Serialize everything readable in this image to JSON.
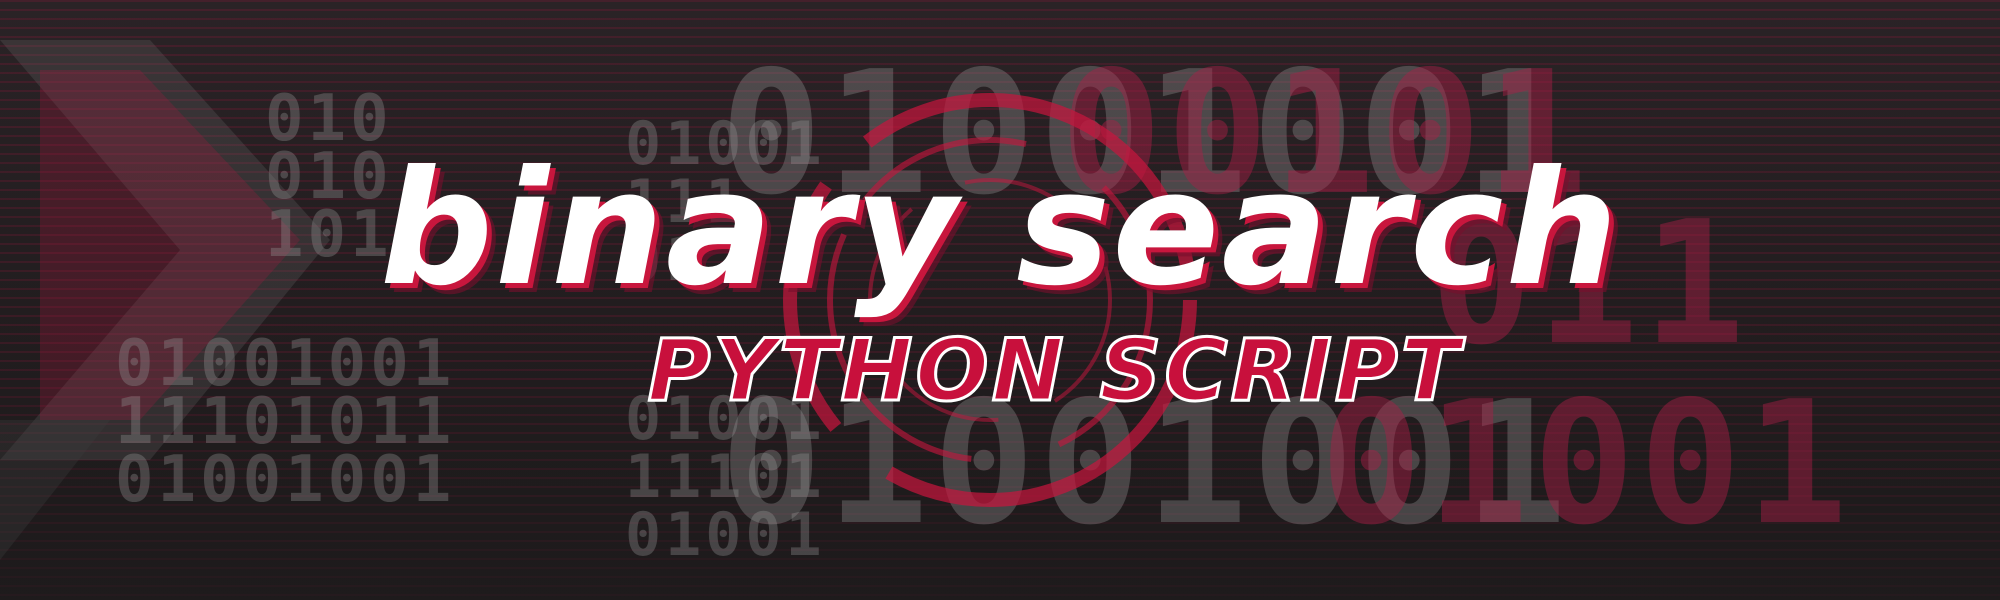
{
  "banner": {
    "title": "binary search",
    "subtitle": "PYTHON SCRIPT",
    "colors": {
      "background": "#221d1f",
      "accent": "#c8163d",
      "text": "#ffffff"
    },
    "background_digits": {
      "large_top_grey": "01001001",
      "large_top_red": "00101",
      "large_right_red": "011",
      "large_bottom_grey": "01001001",
      "large_bottom_red": "01001",
      "small_left_grey": "010\n010\n101",
      "small_mid_grey": "01001\n111\n01",
      "small_bottom_left": "01001001\n11101011\n01001001",
      "small_bottom_mid": "01001\n11101\n01001"
    }
  }
}
